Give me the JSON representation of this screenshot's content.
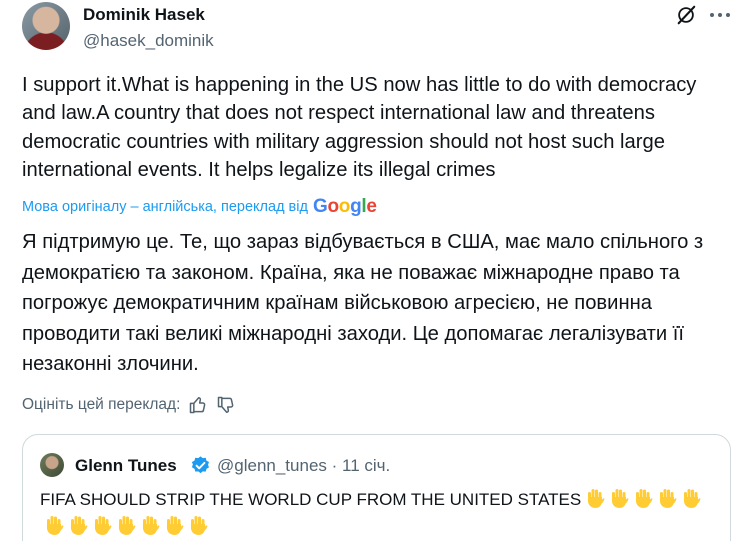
{
  "author": {
    "name": "Dominik Hasek",
    "handle": "@hasek_dominik"
  },
  "icons": {
    "grok": "grok-icon",
    "more": "more-icon",
    "like": "thumbs-up-icon",
    "dislike": "thumbs-down-icon",
    "verified": "verified-badge-icon",
    "hand": "raised-hand-emoji"
  },
  "post": {
    "original_text": "I support it.What is happening in the US now has little to do with democracy and law.A country that does not respect international law and threatens democratic countries with military aggression should not host such large international events. It helps legalize its illegal crimes",
    "translation_note": "Мова оригіналу – англійська, переклад від",
    "translation_provider": "Google",
    "translated_text": "Я підтримую це. Те, що зараз відбувається в США, має мало спільного з демократією та законом. Країна, яка не поважає міжнародне право та погрожує демократичним країнам військовою агресією, не повинна проводити такі великі міжнародні заходи. Це допомагає легалізувати її незаконні злочини.",
    "rate_label": "Оцініть цей переклад:"
  },
  "quote": {
    "name": "Glenn Tunes",
    "handle_time": "@glenn_tunes · 11 січ.",
    "text": "FIFA SHOULD STRIP THE WORLD CUP FROM THE UNITED STATES",
    "hand_emoji_count": 12
  },
  "colors": {
    "accent": "#1d9bf0",
    "secondary_text": "#536471",
    "border": "#cfd9de",
    "emoji": "#ffcc33"
  }
}
